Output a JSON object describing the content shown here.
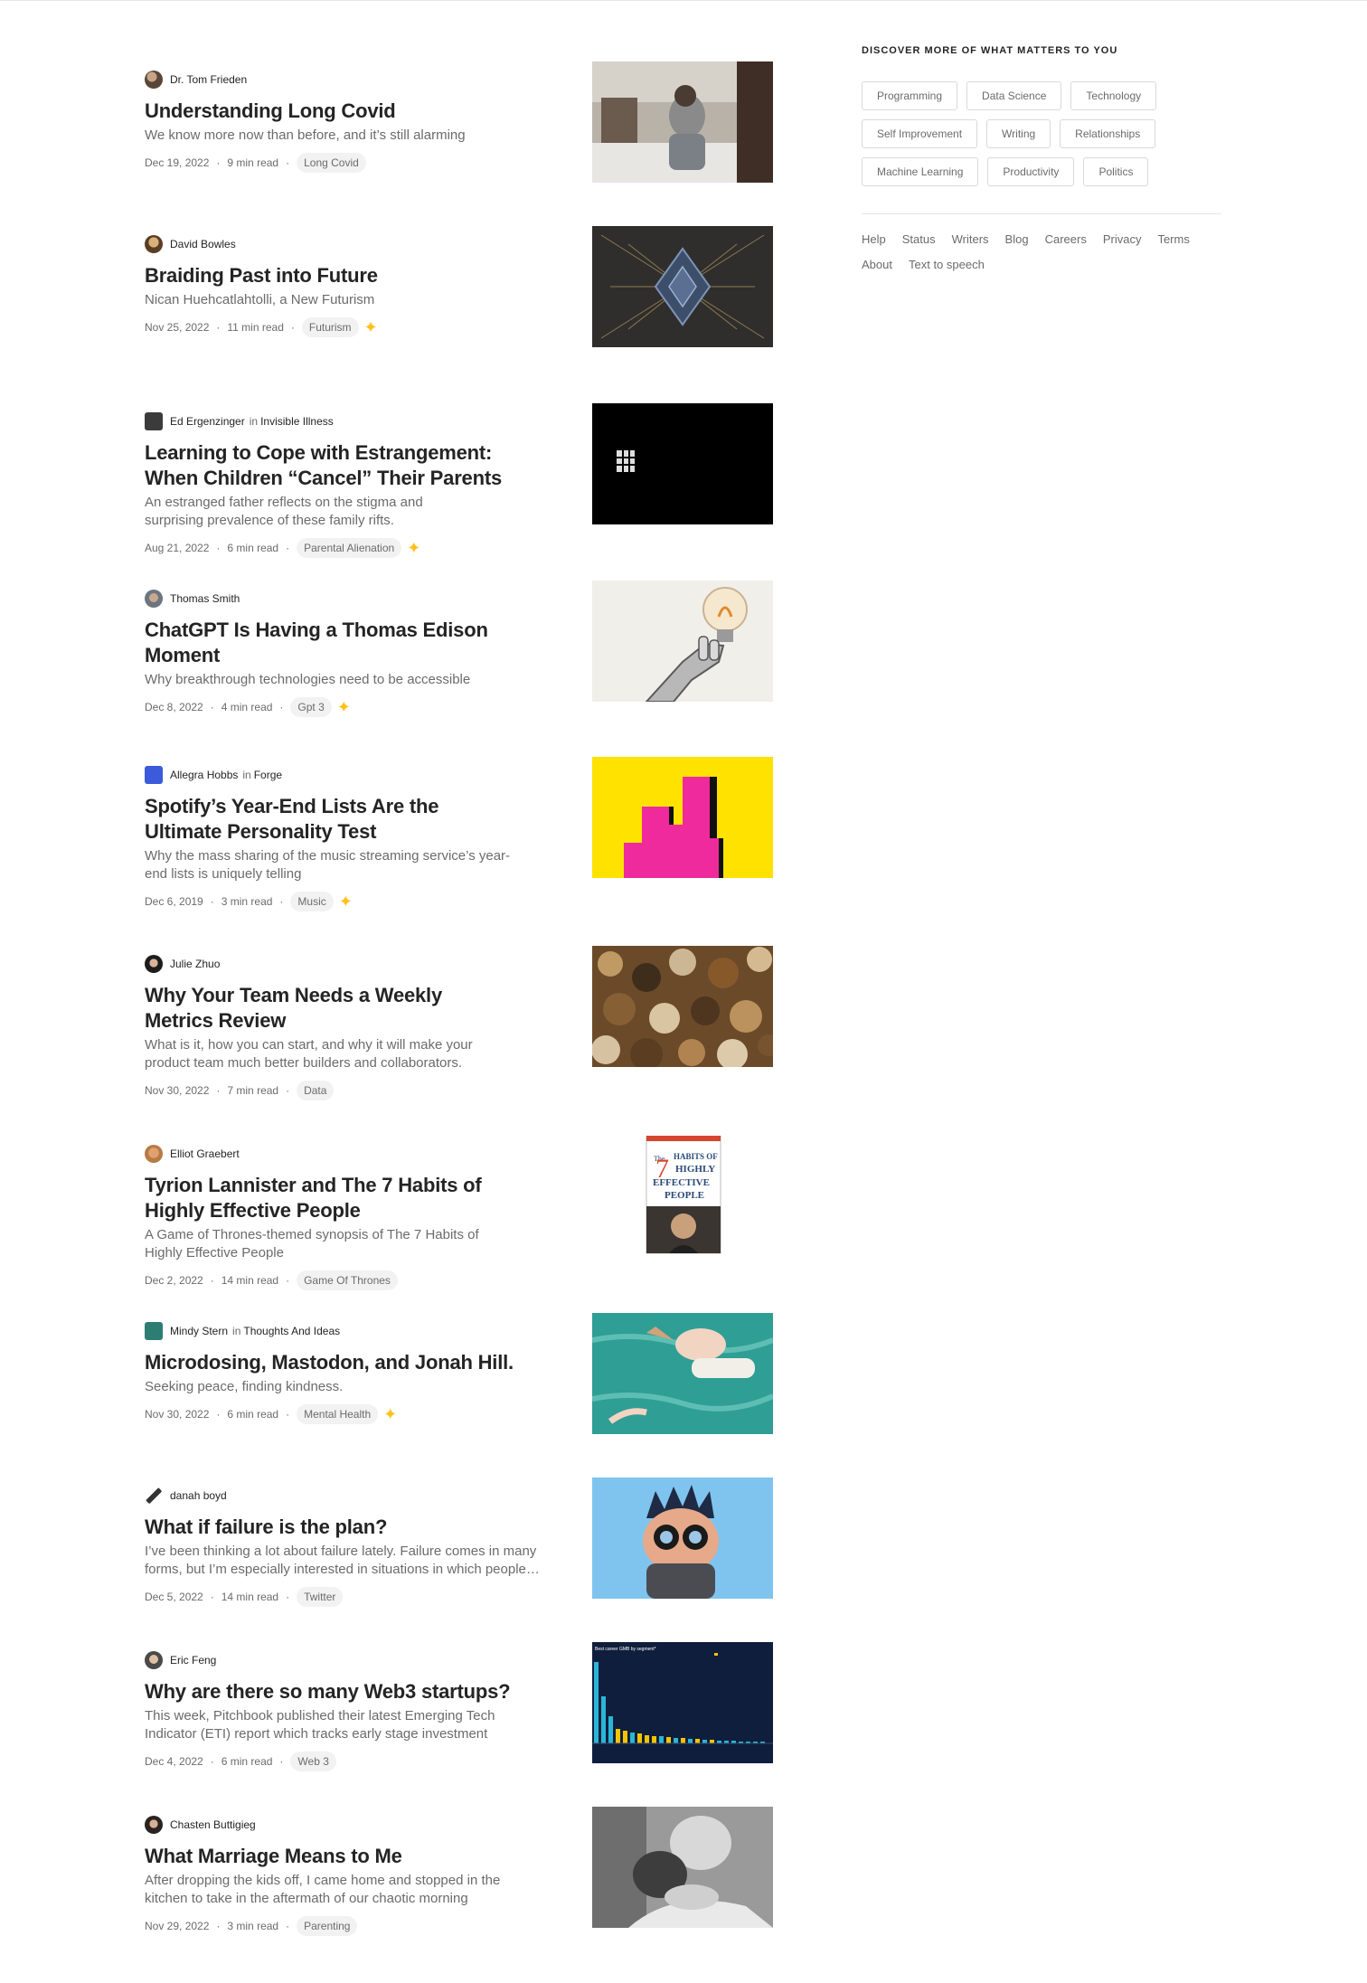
{
  "articles": [
    {
      "author": "Dr. Tom Frieden",
      "publication": "",
      "title_lines": [
        "Understanding Long Covid"
      ],
      "subtitle_lines": [
        "We know more now than before, and it’s still alarming"
      ],
      "date": "Dec 19, 2022",
      "read_time": "9 min read",
      "tag": "Long Covid",
      "member_only": false
    },
    {
      "author": "David Bowles",
      "publication": "",
      "title_lines": [
        "Braiding Past into Future"
      ],
      "subtitle_lines": [
        "Nican Huehcatlahtolli, a New Futurism"
      ],
      "date": "Nov 25, 2022",
      "read_time": "11 min read",
      "tag": "Futurism",
      "member_only": true
    },
    {
      "author": "Ed Ergenzinger",
      "publication": "Invisible Illness",
      "title_lines": [
        "Learning to Cope with Estrangement:",
        "When Children “Cancel” Their Parents"
      ],
      "subtitle_lines": [
        "An estranged father reflects on the stigma and",
        "surprising prevalence of these family rifts."
      ],
      "date": "Aug 21, 2022",
      "read_time": "6 min read",
      "tag": "Parental Alienation",
      "member_only": true
    },
    {
      "author": "Thomas Smith",
      "publication": "",
      "title_lines": [
        "ChatGPT Is Having a Thomas Edison Moment"
      ],
      "subtitle_lines": [
        "Why breakthrough technologies need to be accessible"
      ],
      "date": "Dec 8, 2022",
      "read_time": "4 min read",
      "tag": "Gpt 3",
      "member_only": true
    },
    {
      "author": "Allegra Hobbs",
      "publication": "Forge",
      "title_lines": [
        "Spotify’s Year-End Lists Are the",
        "Ultimate Personality Test"
      ],
      "subtitle_lines": [
        "Why the mass sharing of the music streaming service’s year-",
        "end lists is uniquely telling"
      ],
      "date": "Dec 6, 2019",
      "read_time": "3 min read",
      "tag": "Music",
      "member_only": true
    },
    {
      "author": "Julie Zhuo",
      "publication": "",
      "title_lines": [
        "Why Your Team Needs a Weekly",
        "Metrics Review"
      ],
      "subtitle_lines": [
        "What is it, how you can start, and why it will make your",
        "product team much better builders and collaborators."
      ],
      "date": "Nov 30, 2022",
      "read_time": "7 min read",
      "tag": "Data",
      "member_only": false
    },
    {
      "author": "Elliot Graebert",
      "publication": "",
      "title_lines": [
        "Tyrion Lannister and The 7 Habits of",
        "Highly Effective People"
      ],
      "subtitle_lines": [
        "A Game of Thrones-themed synopsis of The 7 Habits of",
        "Highly Effective People"
      ],
      "date": "Dec 2, 2022",
      "read_time": "14 min read",
      "tag": "Game Of Thrones",
      "member_only": false
    },
    {
      "author": "Mindy Stern",
      "publication": "Thoughts And Ideas",
      "title_lines": [
        "Microdosing, Mastodon, and Jonah Hill."
      ],
      "subtitle_lines": [
        "Seeking peace, finding kindness."
      ],
      "date": "Nov 30, 2022",
      "read_time": "6 min read",
      "tag": "Mental Health",
      "member_only": true
    },
    {
      "author": "danah boyd",
      "publication": "",
      "title_lines": [
        "What if failure is the plan?"
      ],
      "subtitle_lines": [
        "I’ve been thinking a lot about failure lately. Failure comes in many",
        "forms, but I’m especially interested in situations in which people…"
      ],
      "date": "Dec 5, 2022",
      "read_time": "14 min read",
      "tag": "Twitter",
      "member_only": false
    },
    {
      "author": "Eric Feng",
      "publication": "",
      "title_lines": [
        "Why are there so many Web3 startups?"
      ],
      "subtitle_lines": [
        "This week, Pitchbook published their latest Emerging Tech",
        "Indicator (ETI) report which tracks early stage investment"
      ],
      "date": "Dec 4, 2022",
      "read_time": "6 min read",
      "tag": "Web 3",
      "member_only": false
    },
    {
      "author": "Chasten Buttigieg",
      "publication": "",
      "title_lines": [
        "What Marriage Means to Me"
      ],
      "subtitle_lines": [
        "After dropping the kids off, I came home and stopped in the",
        "kitchen to take in the aftermath of our chaotic morning"
      ],
      "date": "Nov 29, 2022",
      "read_time": "3 min read",
      "tag": "Parenting",
      "member_only": false
    }
  ],
  "sidebar": {
    "heading": "DISCOVER MORE OF WHAT MATTERS TO YOU",
    "topics": [
      "Programming",
      "Data Science",
      "Technology",
      "Self Improvement",
      "Writing",
      "Relationships",
      "Machine Learning",
      "Productivity",
      "Politics"
    ],
    "footer_links": [
      "Help",
      "Status",
      "Writers",
      "Blog",
      "Careers",
      "Privacy",
      "Terms",
      "About",
      "Text to speech"
    ]
  },
  "thumbnails": {
    "book_cover_text": [
      "The",
      "7",
      "HABITS OF",
      "HIGHLY",
      "EFFECTIVE",
      "PEOPLE"
    ],
    "chart_title": "Best career GMB by segment*"
  },
  "colors": {
    "text_primary": "#242424",
    "text_secondary": "#6b6b6b",
    "tag_bg": "#f2f2f2",
    "member_star": "#ffc017",
    "divider": "#e6e6e6"
  },
  "icons": {
    "member_star": "✦"
  }
}
